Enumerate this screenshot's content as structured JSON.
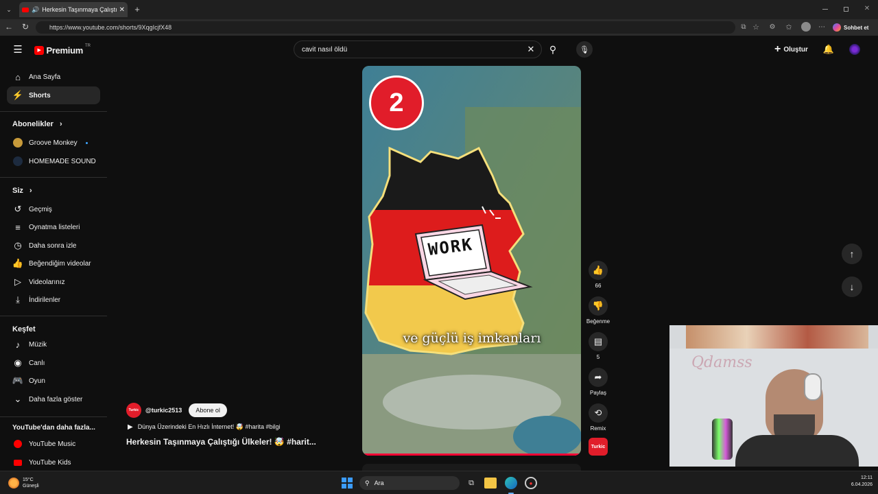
{
  "browser": {
    "tab_title": "Herkesin Taşınmaya Çalıştığı Ü",
    "url": "https://www.youtube.com/shorts/9XqgIcjfX48",
    "copilot_label": "Sohbet et"
  },
  "header": {
    "logo_text": "Premium",
    "logo_region": "TR",
    "search_value": "cavit nasıl öldü",
    "create_label": "Oluştur"
  },
  "sidebar": {
    "main": [
      {
        "label": "Ana Sayfa"
      },
      {
        "label": "Shorts"
      }
    ],
    "subs_header": "Abonelikler",
    "subs": [
      {
        "label": "Groove Monkey"
      },
      {
        "label": "HOMEMADE SOUND"
      }
    ],
    "you_header": "Siz",
    "you": [
      {
        "label": "Geçmiş"
      },
      {
        "label": "Oynatma listeleri"
      },
      {
        "label": "Daha sonra izle"
      },
      {
        "label": "Beğendiğim videolar"
      },
      {
        "label": "Videolarınız"
      },
      {
        "label": "İndirilenler"
      }
    ],
    "explore_header": "Keşfet",
    "explore": [
      {
        "label": "Müzik"
      },
      {
        "label": "Canlı"
      },
      {
        "label": "Oyun"
      },
      {
        "label": "Daha fazla göster"
      }
    ],
    "more_header": "YouTube'dan daha fazla...",
    "more": [
      {
        "label": "YouTube Music"
      },
      {
        "label": "YouTube Kids"
      }
    ]
  },
  "short": {
    "badge_number": "2",
    "laptop_text": "WORK",
    "caption": "ve güçlü iş imkanları",
    "channel_avatar_text": "Turkic",
    "channel": "@turkic2513",
    "subscribe_label": "Abone ol",
    "playlist": "Dünya Üzerindeki En Hızlı İnternet! 🤯 #harita #bilgi",
    "title": "Herkesin Taşınmaya Çalıştığı Ülkeler! 🤯 #harit..."
  },
  "actions": {
    "likes": "66",
    "dislike_label": "Beğenme",
    "comments": "5",
    "share_label": "Paylaş",
    "remix_label": "Remix",
    "channel_badge": "Turkic"
  },
  "webcam": {
    "overlay_text": "Qdamss"
  },
  "taskbar": {
    "temp": "15°C",
    "weather": "Güneşli",
    "search_label": "Ara",
    "time": "12:11",
    "date": "6.04.2026"
  },
  "colors": {
    "youtube_red": "#ff0000",
    "flag_black": "#1a1a1a",
    "flag_red": "#dd1c1c",
    "flag_gold": "#f2c94c"
  }
}
